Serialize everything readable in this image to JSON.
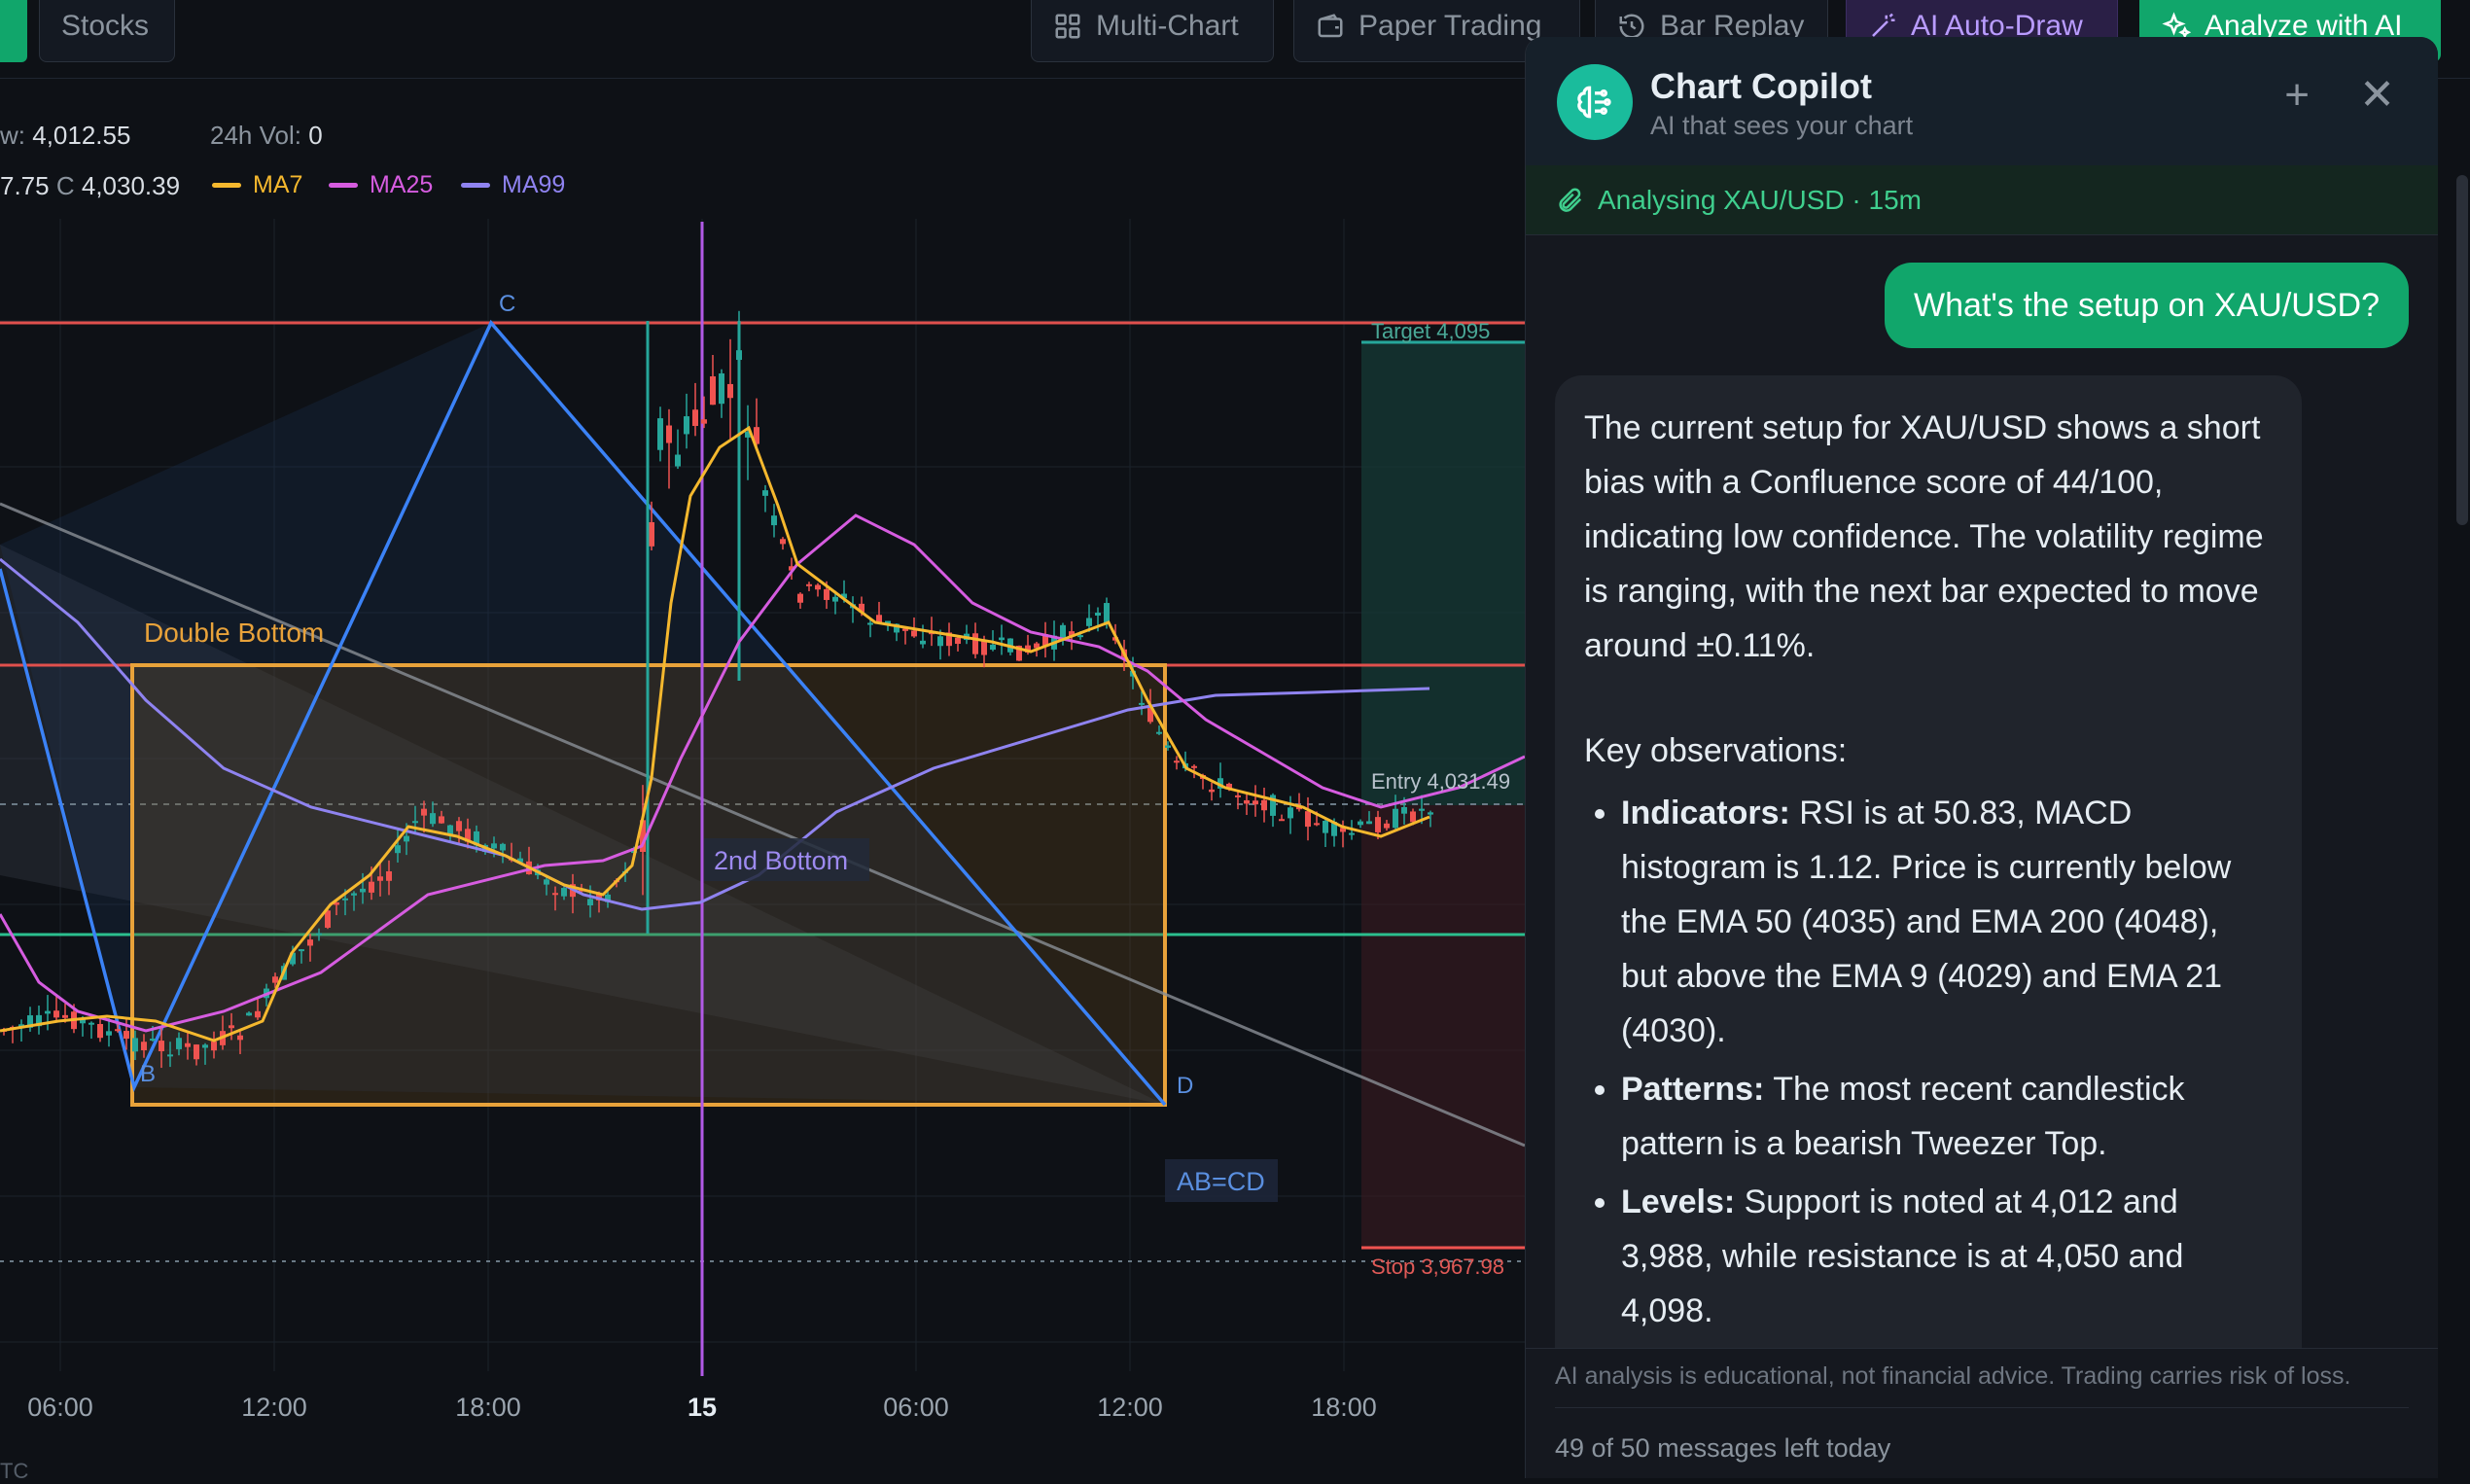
{
  "toolbar": {
    "stocks": "Stocks",
    "multi_chart": "Multi-Chart",
    "paper_trading": "Paper Trading",
    "bar_replay": "Bar Replay",
    "ai_auto_draw": "AI Auto-Draw",
    "analyze": "Analyze with AI"
  },
  "stats": {
    "low_label": "w:",
    "low_value": "4,012.55",
    "vol_label": "24h Vol:",
    "vol_value": "0",
    "ohlc_prefix": "7.75",
    "close_label": "C",
    "close_value": "4,030.39"
  },
  "moving_averages": [
    {
      "label": "MA7",
      "color": "#f5b82e"
    },
    {
      "label": "MA25",
      "color": "#d65ce0"
    },
    {
      "label": "MA99",
      "color": "#8f83f0"
    }
  ],
  "chart": {
    "annotations": {
      "point_c": "C",
      "point_b": "B",
      "point_d": "D",
      "double_bottom": "Double Bottom",
      "second_bottom": "2nd Bottom",
      "abcd": "AB=CD",
      "target": "Target 4,095",
      "entry": "Entry 4,031.49",
      "stop": "Stop 3,967.98"
    },
    "time_axis": [
      "06:00",
      "12:00",
      "18:00",
      "15",
      "06:00",
      "12:00",
      "18:00"
    ],
    "timezone": "TC",
    "colors": {
      "up": "#26a69a",
      "down": "#ef5350",
      "pattern": "#e8a23a",
      "harmonic": "#3b82f6"
    }
  },
  "copilot": {
    "title": "Chart Copilot",
    "subtitle": "AI that sees your chart",
    "status": "Analysing XAU/USD · 15m",
    "user_message": "What's the setup on XAU/USD?",
    "reply_intro": "The current setup for XAU/USD shows a short bias with a Confluence score of 44/100, indicating low confidence. The volatility regime is ranging, with the next bar expected to move around ±0.11%.",
    "reply_key_obs": "Key observations:",
    "bullets": [
      {
        "head": "Indicators:",
        "text": " RSI is at 50.83, MACD histogram is 1.12. Price is currently below the EMA 50 (4035) and EMA 200 (4048), but above the EMA 9 (4029) and EMA 21 (4030)."
      },
      {
        "head": "Patterns:",
        "text": " The most recent candlestick pattern is a bearish Tweezer Top."
      },
      {
        "head": "Levels:",
        "text": " Support is noted at 4,012 and 3,988, while resistance is at 4,050 and 4,098."
      }
    ],
    "disclaimer": "AI analysis is educational, not financial advice. Trading carries risk of loss.",
    "limit": "49 of 50 messages left today"
  }
}
